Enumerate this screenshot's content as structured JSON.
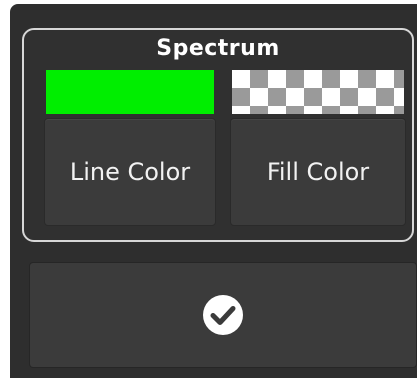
{
  "panel": {
    "title": "Spectrum"
  },
  "line_color": {
    "label": "Line Color",
    "swatch_color": "#00ee00"
  },
  "fill_color": {
    "label": "Fill Color",
    "swatch": "transparent"
  },
  "confirm": {
    "icon": "checkmark-circle-icon"
  }
}
